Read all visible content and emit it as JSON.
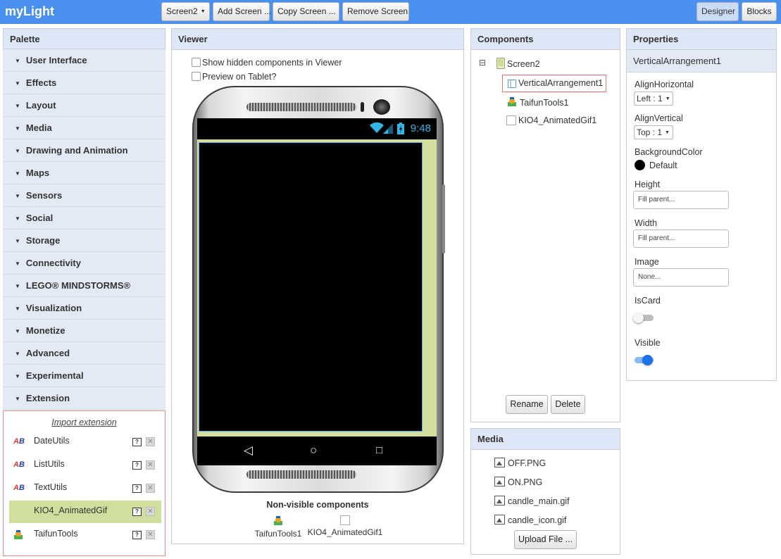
{
  "app": {
    "title": "myLight"
  },
  "toolbar": {
    "screen_select": "Screen2",
    "add_screen": "Add Screen ...",
    "copy_screen": "Copy Screen ...",
    "remove_screen": "Remove Screen",
    "designer": "Designer",
    "blocks": "Blocks"
  },
  "palette": {
    "title": "Palette",
    "categories": [
      "User Interface",
      "Effects",
      "Layout",
      "Media",
      "Drawing and Animation",
      "Maps",
      "Sensors",
      "Social",
      "Storage",
      "Connectivity",
      "LEGO® MINDSTORMS®",
      "Visualization",
      "Monetize",
      "Advanced",
      "Experimental",
      "Extension"
    ],
    "import_extension": "Import extension",
    "extensions": [
      "DateUtils",
      "ListUtils",
      "TextUtils",
      "KIO4_AnimatedGif",
      "TaifunTools"
    ],
    "help_glyph": "?",
    "delete_glyph": "✕"
  },
  "viewer": {
    "title": "Viewer",
    "show_hidden": "Show hidden components in Viewer",
    "preview_tablet": "Preview on Tablet?",
    "clock": "9:48",
    "non_visible_title": "Non-visible components",
    "non_visible": [
      "TaifunTools1",
      "KIO4_AnimatedGif1"
    ]
  },
  "components": {
    "title": "Components",
    "tree": [
      "Screen2",
      "VerticalArrangement1",
      "TaifunTools1",
      "KIO4_AnimatedGif1"
    ],
    "collapse_glyph": "⊟",
    "rename": "Rename",
    "delete": "Delete"
  },
  "media": {
    "title": "Media",
    "files": [
      "OFF.PNG",
      "ON.PNG",
      "candle_main.gif",
      "candle_icon.gif"
    ],
    "upload": "Upload File ..."
  },
  "properties": {
    "title": "Properties",
    "component": "VerticalArrangement1",
    "align_horizontal_label": "AlignHorizontal",
    "align_horizontal_value": "Left : 1",
    "align_vertical_label": "AlignVertical",
    "align_vertical_value": "Top : 1",
    "bg_color_label": "BackgroundColor",
    "bg_color_value": "Default",
    "height_label": "Height",
    "height_value": "Fill parent...",
    "width_label": "Width",
    "width_value": "Fill parent...",
    "image_label": "Image",
    "image_value": "None...",
    "iscard_label": "IsCard",
    "iscard_on": false,
    "visible_label": "Visible",
    "visible_on": true
  },
  "colors": {
    "topbar": "#4a90ee",
    "panel_header": "#dde7f7",
    "selected_extension": "#cfdf9e",
    "toggle_on": "#1a73e8",
    "screen_background": "#d3df9f"
  }
}
